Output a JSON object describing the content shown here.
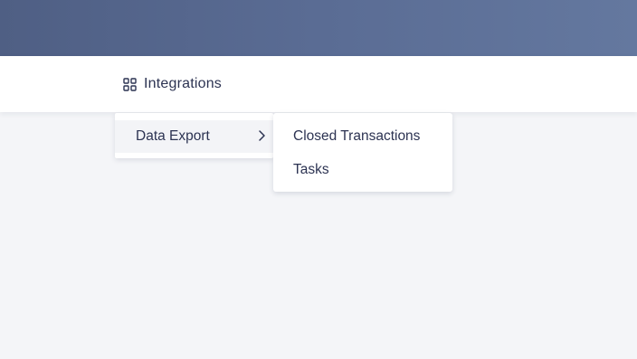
{
  "nav": {
    "integrations_label": "Integrations",
    "icon": "grid-icon"
  },
  "menu": {
    "items": [
      {
        "label": "Data Export",
        "has_submenu": true,
        "icon": "chevron-right-icon"
      }
    ]
  },
  "submenu": {
    "items": [
      {
        "label": "Closed Transactions"
      },
      {
        "label": "Tasks"
      }
    ]
  },
  "colors": {
    "banner_start": "#4f5f84",
    "banner_end": "#64789f",
    "text": "#2c3352",
    "background": "#f4f5f8",
    "hover_row": "#f3f4f7"
  }
}
